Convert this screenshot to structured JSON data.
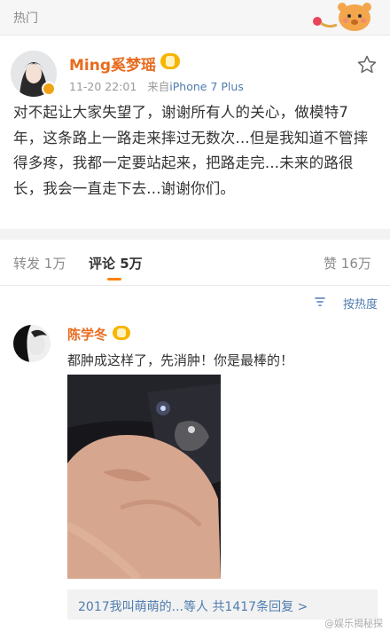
{
  "topbar": {
    "title": "热门"
  },
  "post": {
    "author": "Ming奚梦瑶",
    "date": "11-20 22:01",
    "source_prefix": "来自",
    "device": "iPhone 7 Plus",
    "text": "对不起让大家失望了，谢谢所有人的关心，做模特7年，这条路上一路走来摔过无数次...但是我知道不管摔得多疼，我都一定要站起来，把路走完...未来的路很长，我会一直走下去...谢谢你们。"
  },
  "tabs": {
    "repost_label": "转发",
    "repost_count": "1万",
    "comment_label": "评论",
    "comment_count": "5万",
    "like_label": "赞",
    "like_count": "16万"
  },
  "sort": {
    "label": "按热度"
  },
  "comment": {
    "author": "陈学冬",
    "text": "都肿成这样了，先消肿！你是最棒的！",
    "replies_names": "2017我叫萌萌的...等人",
    "replies_count": "共1417条回复 >"
  },
  "watermark": "@娱乐揭秘探"
}
